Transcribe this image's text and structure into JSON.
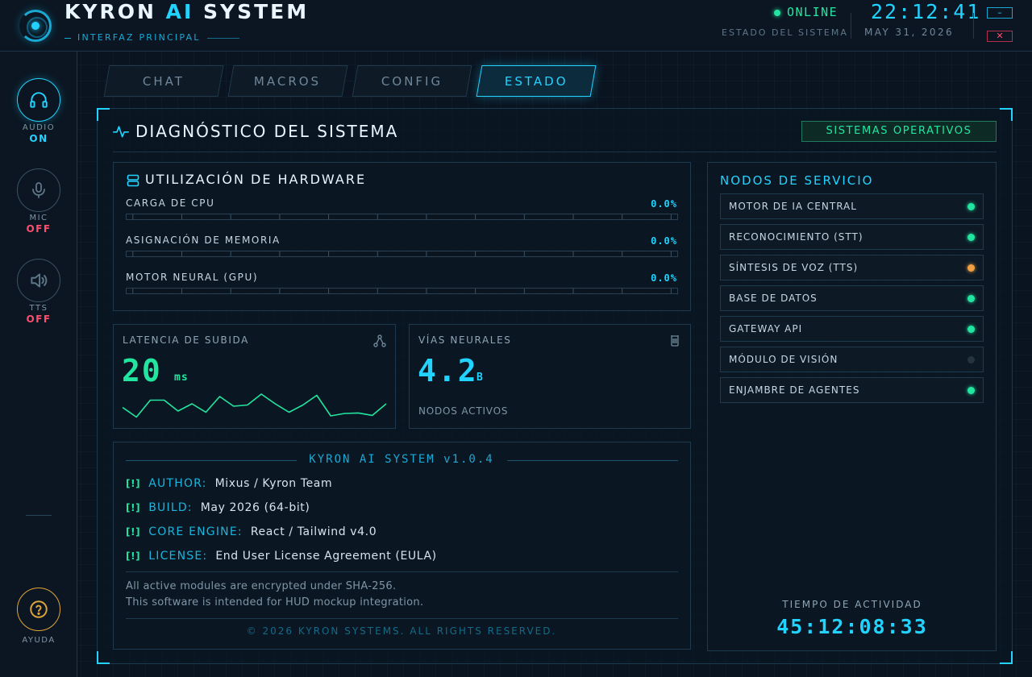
{
  "header": {
    "title_pre": "KYRON ",
    "title_ai": "AI",
    "title_post": " SYSTEM",
    "subtitle": "INTERFAZ PRINCIPAL",
    "status": "ONLINE",
    "status_label": "ESTADO DEL SISTEMA",
    "time": "22:12:41",
    "date": "MAY 31, 2026",
    "minimize": "–",
    "close": "✕"
  },
  "sidebar": {
    "audio": {
      "label": "AUDIO",
      "state": "ON",
      "icon": "headphones-icon"
    },
    "mic": {
      "label": "MIC",
      "state": "OFF",
      "icon": "microphone-icon"
    },
    "tts": {
      "label": "TTS",
      "state": "OFF",
      "icon": "speaker-icon"
    },
    "help": {
      "label": "AYUDA",
      "icon": "help-icon"
    }
  },
  "tabs": [
    {
      "label": "CHAT"
    },
    {
      "label": "MACROS"
    },
    {
      "label": "CONFIG"
    },
    {
      "label": "ESTADO",
      "active": true
    }
  ],
  "diagnostics": {
    "title": "DIAGNÓSTICO DEL SISTEMA",
    "badge": "SISTEMAS OPERATIVOS"
  },
  "hardware": {
    "title": "UTILIZACIÓN DE HARDWARE",
    "metrics": [
      {
        "label": "CARGA DE CPU",
        "value": "0.0%",
        "fraction": 0.0
      },
      {
        "label": "ASIGNACIÓN DE MEMORIA",
        "value": "0.0%",
        "fraction": 0.0
      },
      {
        "label": "MOTOR NEURAL (GPU)",
        "value": "0.0%",
        "fraction": 0.0
      }
    ]
  },
  "latency": {
    "label": "LATENCIA DE SUBIDA",
    "value": "20",
    "unit": "ms",
    "spark": [
      0.45,
      0.05,
      0.75,
      0.75,
      0.3,
      0.6,
      0.25,
      0.9,
      0.5,
      0.55,
      1.0,
      0.6,
      0.25,
      0.55,
      0.95,
      0.1,
      0.2,
      0.22,
      0.12,
      0.6
    ]
  },
  "neural": {
    "label": "VÍAS NEURALES",
    "value": "4.2",
    "unit": "B",
    "sub": "NODOS ACTIVOS"
  },
  "about": {
    "title": "KYRON AI SYSTEM v1.0.4",
    "tag": "[!]",
    "rows": [
      {
        "key": "AUTHOR:",
        "value": "Mixus / Kyron Team"
      },
      {
        "key": "BUILD:",
        "value": "May 2026 (64-bit)"
      },
      {
        "key": "CORE ENGINE:",
        "value": "React / Tailwind v4.0"
      },
      {
        "key": "LICENSE:",
        "value": "End User License Agreement (EULA)"
      }
    ],
    "note1": "All active modules are encrypted under SHA-256.",
    "note2": "This software is intended for HUD mockup integration.",
    "copyright": "© 2026 KYRON SYSTEMS. ALL RIGHTS RESERVED."
  },
  "nodes": {
    "title": "NODOS DE SERVICIO",
    "items": [
      {
        "name": "MOTOR DE IA CENTRAL",
        "status_color": "#22e6a0"
      },
      {
        "name": "RECONOCIMIENTO (STT)",
        "status_color": "#22e6a0"
      },
      {
        "name": "SÍNTESIS DE VOZ (TTS)",
        "status_color": "#f0a040"
      },
      {
        "name": "BASE DE DATOS",
        "status_color": "#22e6a0"
      },
      {
        "name": "GATEWAY API",
        "status_color": "#22e6a0"
      },
      {
        "name": "MÓDULO DE VISIÓN",
        "status_color": "#26343f"
      },
      {
        "name": "ENJAMBRE DE AGENTES",
        "status_color": "#22e6a0"
      }
    ],
    "uptime_label": "TIEMPO DE ACTIVIDAD",
    "uptime": "45:12:08:33"
  },
  "colors": {
    "accent": "#22d3ff",
    "ok": "#22e6a0",
    "warn": "#f0a040",
    "off": "#ff4d6d"
  }
}
